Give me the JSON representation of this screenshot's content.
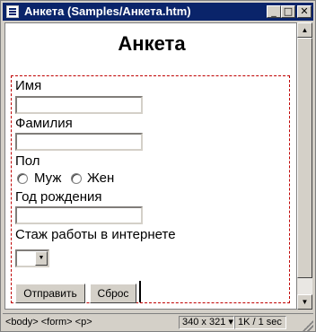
{
  "window": {
    "title": "Анкета (Samples/Анкета.htm)",
    "controls": {
      "minimize": "_",
      "maximize": "□",
      "close": "✕"
    }
  },
  "document": {
    "heading": "Анкета",
    "form": {
      "first_name_label": "Имя",
      "first_name_value": "",
      "last_name_label": "Фамилия",
      "last_name_value": "",
      "gender_label": "Пол",
      "gender_options": [
        "Муж",
        "Жен"
      ],
      "birth_year_label": "Год рождения",
      "birth_year_value": "",
      "experience_label": "Стаж работы в интернете",
      "experience_selected": "",
      "submit_label": "Отправить",
      "reset_label": "Сброс"
    }
  },
  "status_bar": {
    "tag_path": "<body> <form> <p>",
    "window_size": "340 x 321",
    "file_info": "1K / 1 sec"
  },
  "icons": {
    "scroll_up": "up-arrow-icon",
    "scroll_down": "down-arrow-icon",
    "select_arrow": "chevron-down-icon"
  }
}
